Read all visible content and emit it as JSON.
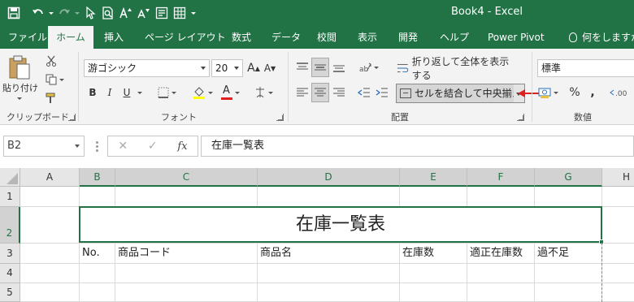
{
  "window": {
    "title": "Book4  -  Excel"
  },
  "qat": {
    "items": [
      "save-icon",
      "undo-icon",
      "redo-icon",
      "select-icon",
      "print-preview-icon",
      "increase-font-icon",
      "decrease-font-icon",
      "form-icon",
      "sheet-icon"
    ]
  },
  "tabs": [
    "ファイル",
    "ホーム",
    "挿入",
    "ページ レイアウト",
    "数式",
    "データ",
    "校閲",
    "表示",
    "開発",
    "ヘルプ",
    "Power Pivot"
  ],
  "active_tab": "ホーム",
  "tell_me": "何をしますか",
  "ribbon": {
    "clipboard": {
      "paste_label": "貼り付け",
      "group_label": "クリップボード"
    },
    "font": {
      "font_name": "游ゴシック",
      "font_size": "20",
      "grow": "A",
      "shrink": "A",
      "bold": "B",
      "italic": "I",
      "underline": "U",
      "font_color_glyph": "A",
      "group_label": "フォント"
    },
    "alignment": {
      "wrap_text": "折り返して全体を表示する",
      "merge_center": "セルを結合して中央揃え",
      "group_label": "配置"
    },
    "number": {
      "format": "標準",
      "percent": "%",
      "comma": ",",
      "group_label": "数値"
    }
  },
  "formula_bar": {
    "name_box": "B2",
    "cancel": "✕",
    "enter": "✓",
    "fx": "fx",
    "content": "在庫一覧表"
  },
  "grid": {
    "columns": [
      "A",
      "B",
      "C",
      "D",
      "E",
      "F",
      "G",
      "H"
    ],
    "rows": [
      "1",
      "2",
      "3",
      "4",
      "5"
    ],
    "selected_cell": "B2",
    "merged_title": "在庫一覧表",
    "row3": [
      "No.",
      "商品コード",
      "商品名",
      "在庫数",
      "適正在庫数",
      "過不足"
    ]
  },
  "colors": {
    "excel_green": "#217346",
    "annotation_arrow": "#e02020"
  }
}
